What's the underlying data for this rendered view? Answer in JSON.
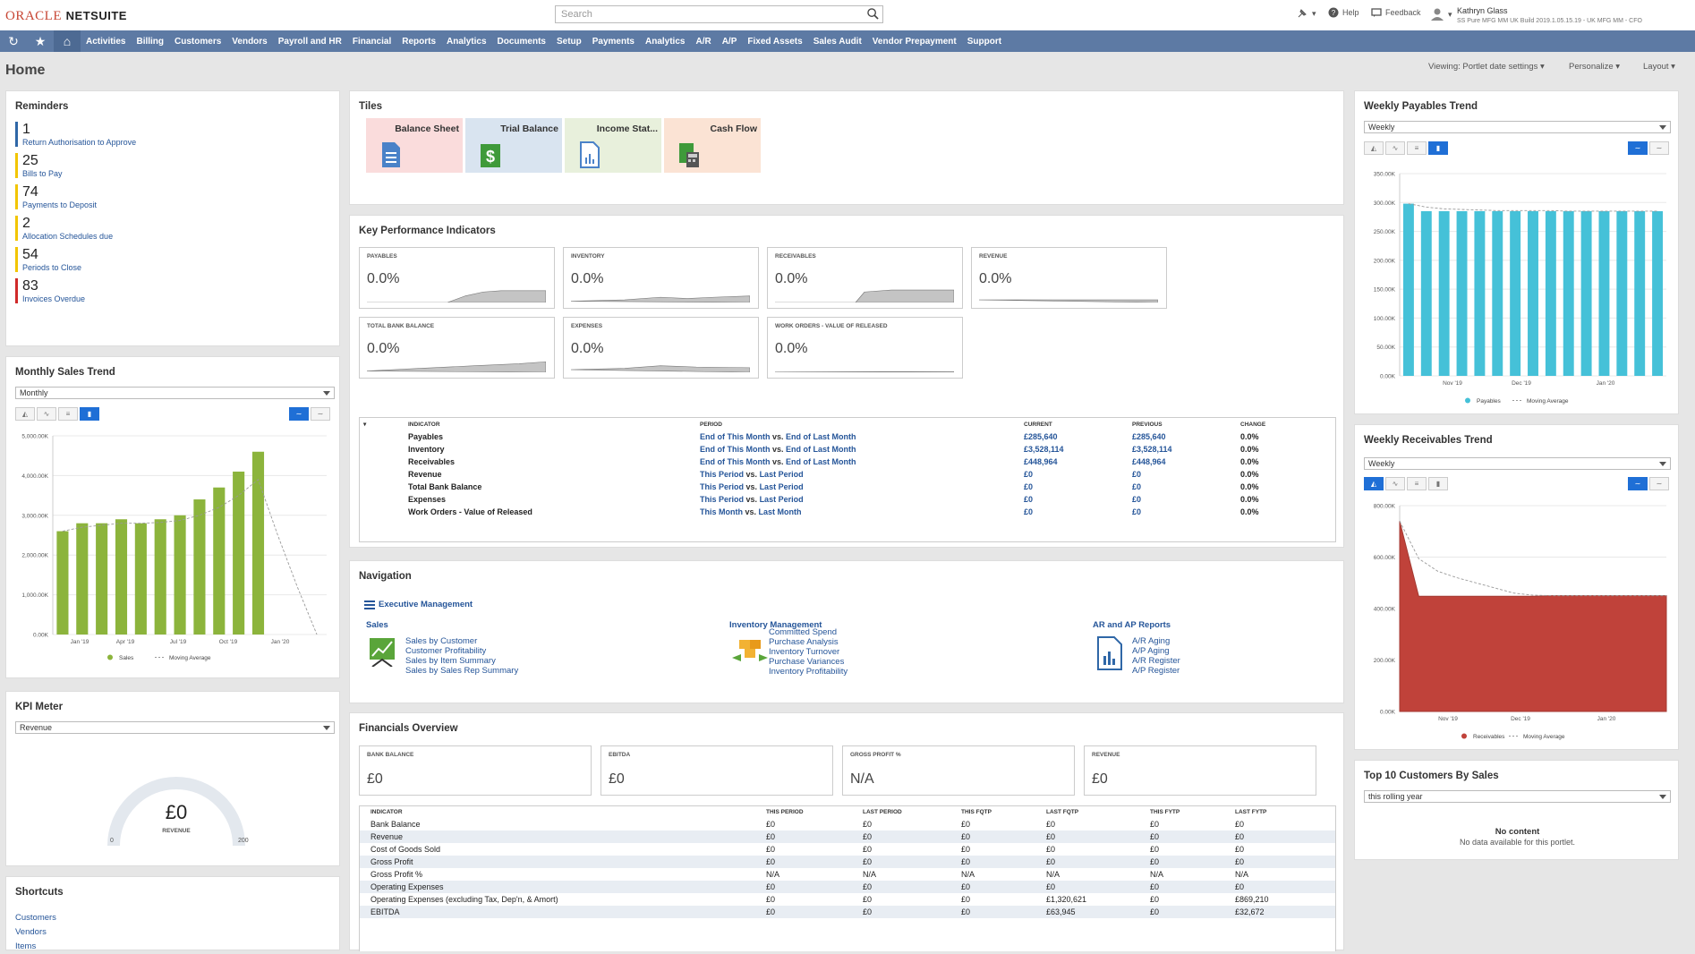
{
  "brand": {
    "oracle": "ORACLE",
    "netsuite": "NETSUITE"
  },
  "search": {
    "placeholder": "Search"
  },
  "topright": {
    "help": "Help",
    "feedback": "Feedback",
    "user_name": "Kathryn Glass",
    "user_role": "SS Pure MFG MM UK Build 2019.1.05.15.19 - UK MFG MM - CFO"
  },
  "nav": [
    "Activities",
    "Billing",
    "Customers",
    "Vendors",
    "Payroll and HR",
    "Financial",
    "Reports",
    "Analytics",
    "Documents",
    "Setup",
    "Payments",
    "Analytics",
    "A/R",
    "A/P",
    "Fixed Assets",
    "Sales Audit",
    "Vendor Prepayment",
    "Support"
  ],
  "page": {
    "title": "Home",
    "viewing": "Viewing: Portlet date settings",
    "personalize": "Personalize",
    "layout": "Layout"
  },
  "reminders": {
    "title": "Reminders",
    "items": [
      {
        "count": "1",
        "label": "Return Authorisation to Approve",
        "color": "#2f67a7"
      },
      {
        "count": "25",
        "label": "Bills to Pay",
        "color": "#f2c500"
      },
      {
        "count": "74",
        "label": "Payments to Deposit",
        "color": "#f2c500"
      },
      {
        "count": "2",
        "label": "Allocation Schedules due",
        "color": "#f2c500"
      },
      {
        "count": "54",
        "label": "Periods to Close",
        "color": "#f2c500"
      },
      {
        "count": "83",
        "label": "Invoices Overdue",
        "color": "#d02a2a"
      }
    ]
  },
  "monthly_sales": {
    "title": "Monthly Sales Trend",
    "select": "Monthly",
    "legend_sales": "Sales",
    "legend_ma": "Moving Average"
  },
  "kpi_meter": {
    "title": "KPI Meter",
    "select": "Revenue",
    "value": "£0",
    "label": "REVENUE",
    "min": "0",
    "max": "200"
  },
  "shortcuts": {
    "title": "Shortcuts",
    "items": [
      "Customers",
      "Vendors",
      "Items"
    ]
  },
  "tiles": {
    "title": "Tiles",
    "items": [
      {
        "label": "Balance Sheet",
        "bg": "#fadcdc"
      },
      {
        "label": "Trial Balance",
        "bg": "#d9e4f0"
      },
      {
        "label": "Income Stat...",
        "bg": "#e8f0dc"
      },
      {
        "label": "Cash Flow",
        "bg": "#fbe3d4"
      }
    ]
  },
  "kpis": {
    "title": "Key Performance Indicators",
    "cards": [
      {
        "label": "PAYABLES",
        "value": "0.0%"
      },
      {
        "label": "INVENTORY",
        "value": "0.0%"
      },
      {
        "label": "RECEIVABLES",
        "value": "0.0%"
      },
      {
        "label": "REVENUE",
        "value": "0.0%"
      },
      {
        "label": "TOTAL BANK BALANCE",
        "value": "0.0%"
      },
      {
        "label": "EXPENSES",
        "value": "0.0%"
      },
      {
        "label": "WORK ORDERS - VALUE OF RELEASED",
        "value": "0.0%"
      }
    ],
    "table_headers": [
      "INDICATOR",
      "PERIOD",
      "CURRENT",
      "PREVIOUS",
      "CHANGE"
    ],
    "rows": [
      {
        "indicator": "Payables",
        "p1": "End of This Month",
        "vs": "vs.",
        "p2": "End of Last Month",
        "current": "£285,640",
        "previous": "£285,640",
        "change": "0.0%"
      },
      {
        "indicator": "Inventory",
        "p1": "End of This Month",
        "vs": "vs.",
        "p2": "End of Last Month",
        "current": "£3,528,114",
        "previous": "£3,528,114",
        "change": "0.0%"
      },
      {
        "indicator": "Receivables",
        "p1": "End of This Month",
        "vs": "vs.",
        "p2": "End of Last Month",
        "current": "£448,964",
        "previous": "£448,964",
        "change": "0.0%"
      },
      {
        "indicator": "Revenue",
        "p1": "This Period",
        "vs": "vs.",
        "p2": "Last Period",
        "current": "£0",
        "previous": "£0",
        "change": "0.0%"
      },
      {
        "indicator": "Total Bank Balance",
        "p1": "This Period",
        "vs": "vs.",
        "p2": "Last Period",
        "current": "£0",
        "previous": "£0",
        "change": "0.0%"
      },
      {
        "indicator": "Expenses",
        "p1": "This Period",
        "vs": "vs.",
        "p2": "Last Period",
        "current": "£0",
        "previous": "£0",
        "change": "0.0%"
      },
      {
        "indicator": "Work Orders - Value of Released",
        "p1": "This Month",
        "vs": "vs.",
        "p2": "Last Month",
        "current": "£0",
        "previous": "£0",
        "change": "0.0%"
      }
    ]
  },
  "navigation": {
    "title": "Navigation",
    "exec": "Executive Management",
    "sales": {
      "title": "Sales",
      "links": [
        "Sales by Customer",
        "Customer Profitability",
        "Sales by Item Summary",
        "Sales by Sales Rep Summary"
      ]
    },
    "inventory": {
      "title": "Inventory Management",
      "links": [
        "Committed Spend",
        "Purchase Analysis",
        "Inventory Turnover",
        "Purchase Variances",
        "Inventory Profitability"
      ]
    },
    "arap": {
      "title": "AR and AP Reports",
      "links": [
        "A/R Aging",
        "A/P Aging",
        "A/R Register",
        "A/P Register"
      ]
    }
  },
  "financials": {
    "title": "Financials Overview",
    "cards": [
      {
        "label": "BANK BALANCE",
        "value": "£0"
      },
      {
        "label": "EBITDA",
        "value": "£0"
      },
      {
        "label": "GROSS PROFIT %",
        "value": "N/A"
      },
      {
        "label": "REVENUE",
        "value": "£0"
      }
    ],
    "headers": [
      "INDICATOR",
      "THIS PERIOD",
      "LAST PERIOD",
      "THIS FQTP",
      "LAST FQTP",
      "THIS FYTP",
      "LAST FYTP"
    ],
    "rows": [
      [
        "Bank Balance",
        "£0",
        "£0",
        "£0",
        "£0",
        "£0",
        "£0"
      ],
      [
        "Revenue",
        "£0",
        "£0",
        "£0",
        "£0",
        "£0",
        "£0"
      ],
      [
        "Cost of Goods Sold",
        "£0",
        "£0",
        "£0",
        "£0",
        "£0",
        "£0"
      ],
      [
        "Gross Profit",
        "£0",
        "£0",
        "£0",
        "£0",
        "£0",
        "£0"
      ],
      [
        "Gross Profit %",
        "N/A",
        "N/A",
        "N/A",
        "N/A",
        "N/A",
        "N/A"
      ],
      [
        "Operating Expenses",
        "£0",
        "£0",
        "£0",
        "£0",
        "£0",
        "£0"
      ],
      [
        "Operating Expenses (excluding Tax, Dep'n, & Amort)",
        "£0",
        "£0",
        "£0",
        "£1,320,621",
        "£0",
        "£869,210"
      ],
      [
        "EBITDA",
        "£0",
        "£0",
        "£0",
        "£63,945",
        "£0",
        "£32,672"
      ]
    ]
  },
  "weekly_payables": {
    "title": "Weekly Payables Trend",
    "select": "Weekly",
    "legend_a": "Payables",
    "legend_b": "Moving Average"
  },
  "weekly_receivables": {
    "title": "Weekly Receivables Trend",
    "select": "Weekly",
    "legend_a": "Receivables",
    "legend_b": "Moving Average"
  },
  "top10": {
    "title": "Top 10 Customers By Sales",
    "select": "this rolling year",
    "empty_title": "No content",
    "empty_msg": "No data available for this portlet."
  },
  "chart_data": [
    {
      "type": "bar",
      "name": "monthly_sales",
      "yticks": [
        "0.00K",
        "1,000.00K",
        "2,000.00K",
        "3,000.00K",
        "4,000.00K",
        "5,000.00K"
      ],
      "xticks": [
        "Jan '19",
        "Apr '19",
        "Jul '19",
        "Oct '19",
        "Jan '20"
      ],
      "ylim": [
        0,
        5000
      ],
      "values": [
        2600,
        2800,
        2800,
        2900,
        2800,
        2900,
        3000,
        3400,
        3700,
        4100,
        4600,
        0,
        0,
        0
      ],
      "moving_average": [
        2600,
        2700,
        2750,
        2800,
        2800,
        2820,
        2870,
        3000,
        3200,
        3500,
        3900,
        2500,
        1200,
        0
      ],
      "color": "#8cb43c"
    },
    {
      "type": "bar",
      "name": "weekly_payables",
      "yticks": [
        "0.00K",
        "50.00K",
        "100.00K",
        "150.00K",
        "200.00K",
        "250.00K",
        "300.00K",
        "350.00K"
      ],
      "xticks": [
        "Nov '19",
        "Dec '19",
        "Jan '20"
      ],
      "ylim": [
        0,
        350
      ],
      "values": [
        298,
        285,
        285,
        285,
        285,
        285,
        285,
        285,
        285,
        285,
        285,
        285,
        285,
        285,
        285
      ],
      "moving_average": [
        298,
        292,
        289,
        288,
        287,
        286,
        286,
        286,
        286,
        285,
        285,
        285,
        285,
        285,
        285
      ],
      "color": "#45c1d8"
    },
    {
      "type": "area",
      "name": "weekly_receivables",
      "yticks": [
        "0.00K",
        "200.00K",
        "400.00K",
        "600.00K",
        "800.00K"
      ],
      "xticks": [
        "Nov '19",
        "Dec '19",
        "Jan '20"
      ],
      "ylim": [
        0,
        800
      ],
      "values": [
        740,
        448,
        448,
        448,
        448,
        448,
        448,
        448,
        450,
        450,
        450,
        450,
        450,
        450,
        450
      ],
      "moving_average": [
        740,
        594,
        545,
        520,
        500,
        480,
        460,
        452,
        450,
        450,
        450,
        450,
        450,
        450,
        450
      ],
      "color": "#c0423a"
    }
  ]
}
